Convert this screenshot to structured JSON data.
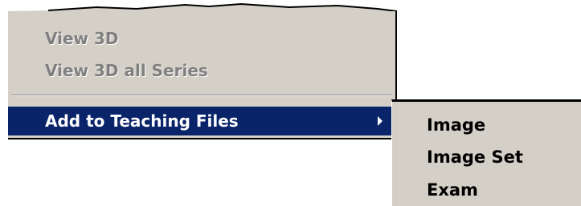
{
  "menu": {
    "items": [
      {
        "label": "View 3D",
        "enabled": false
      },
      {
        "label": "View 3D all Series",
        "enabled": false
      },
      {
        "label": "Add to Teaching Files",
        "enabled": true,
        "highlighted": true,
        "has_submenu": true
      }
    ]
  },
  "submenu": {
    "items": [
      {
        "label": "Image"
      },
      {
        "label": "Image Set"
      },
      {
        "label": "Exam"
      }
    ]
  },
  "colors": {
    "menu_background": "#d4d0c8",
    "highlight": "#0a246a",
    "highlight_text": "#ffffff",
    "disabled_text": "#808080",
    "border": "#000000"
  },
  "icons": {
    "submenu_arrow": "triangle-right-icon"
  }
}
